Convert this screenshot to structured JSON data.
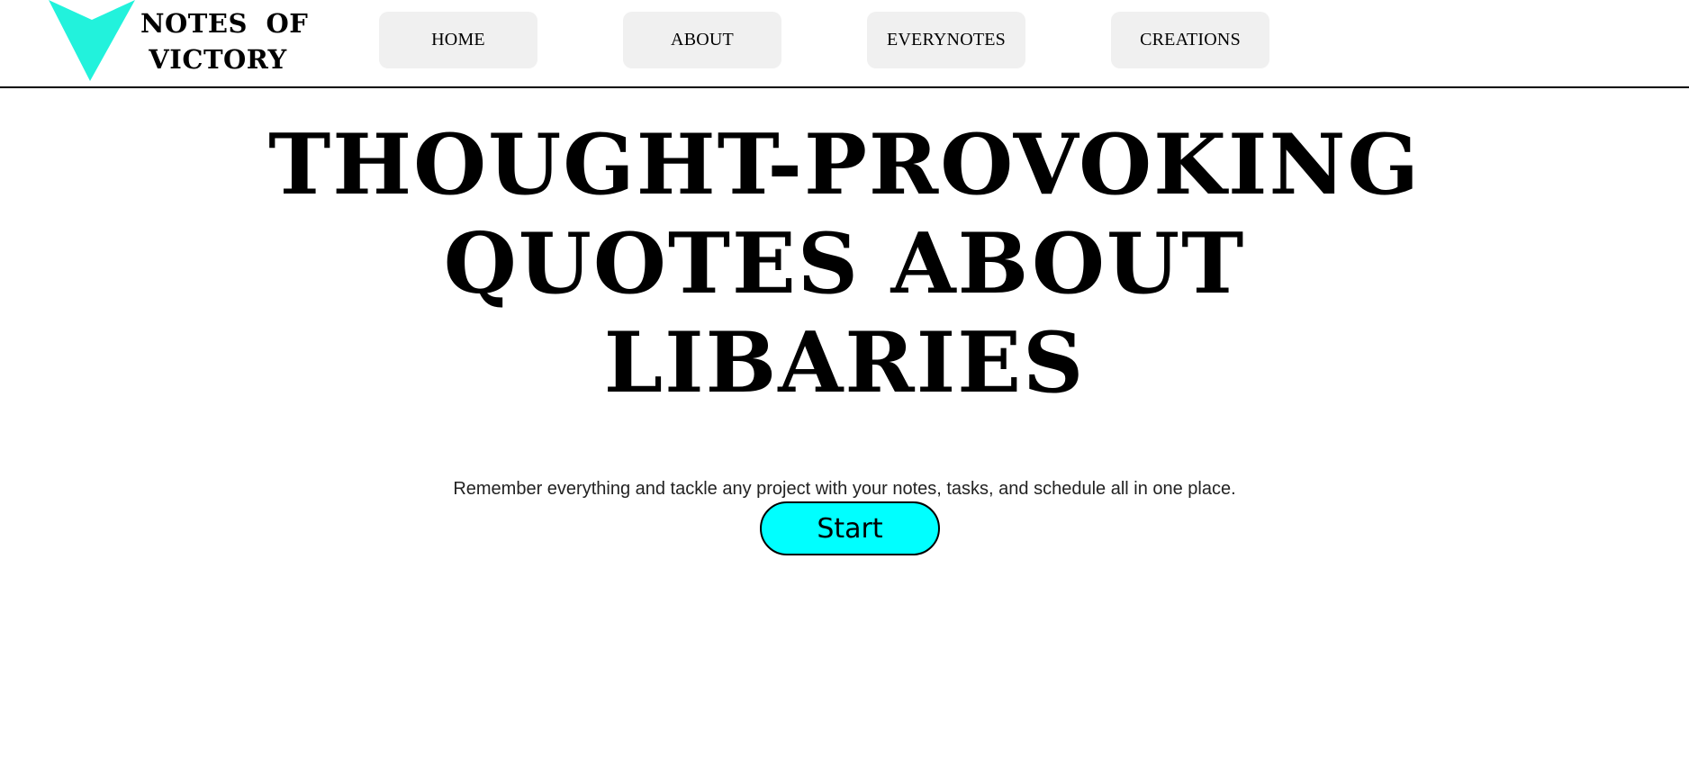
{
  "brand": {
    "name_line1": "NOTES OF",
    "name_line2": "VICTORY",
    "logo_icon": "victory-v-icon",
    "logo_color": "#22f2dc"
  },
  "nav": {
    "items": [
      {
        "label": "HOME"
      },
      {
        "label": "ABOUT"
      },
      {
        "label": "EVERYNOTES"
      },
      {
        "label": "CREATIONS"
      }
    ],
    "button_bg": "#f0f0f0"
  },
  "hero": {
    "title_line1": "THOUGHT-PROVOKING",
    "title_line2": "QUOTES ABOUT",
    "title_line3": "LIBARIES",
    "tagline": "Remember everything and tackle any project with your notes, tasks, and schedule all in one place.",
    "start_label": "Start",
    "start_color": "#00ffff"
  }
}
